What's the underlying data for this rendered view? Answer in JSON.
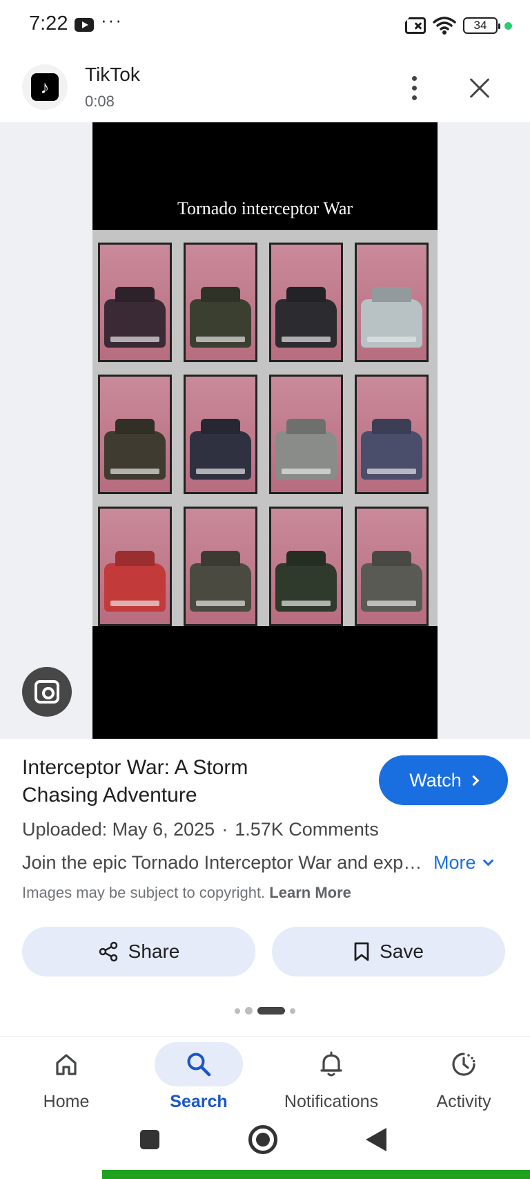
{
  "status_bar": {
    "time": "7:22",
    "dots": "···",
    "battery": "34",
    "icons": [
      "youtube-icon",
      "sim-error-icon",
      "wifi-icon",
      "battery-icon"
    ]
  },
  "source": {
    "name": "TikTok",
    "duration": "0:08",
    "logo_glyph": "♪"
  },
  "video": {
    "overlay_title": "Tornado interceptor War",
    "tile_colors": [
      "#3a2a35",
      "#3b3f30",
      "#2c2b30",
      "#b8c1c4",
      "#3f3b30",
      "#2f3140",
      "#8a8c8a",
      "#4a4e6a",
      "#c23a3a",
      "#4a4a40",
      "#2f3a2c",
      "#5a5a55"
    ]
  },
  "info": {
    "title": "Interceptor War: A Storm Chasing Adventure",
    "watch_label": "Watch",
    "uploaded": "Uploaded: May 6, 2025",
    "separator": "·",
    "comments": "1.57K Comments",
    "description": "Join the epic Tornado Interceptor War and experience the thrill of storm chasing.",
    "more_label": "More",
    "copyright_text": "Images may be subject to copyright.",
    "learn_more": "Learn More",
    "share_label": "Share",
    "save_label": "Save"
  },
  "nav": {
    "home": "Home",
    "search": "Search",
    "notifications": "Notifications",
    "activity": "Activity"
  },
  "colors": {
    "accent": "#1a6fe0",
    "chip_bg": "#e5ebf8",
    "nav_active": "#1a56c8"
  }
}
